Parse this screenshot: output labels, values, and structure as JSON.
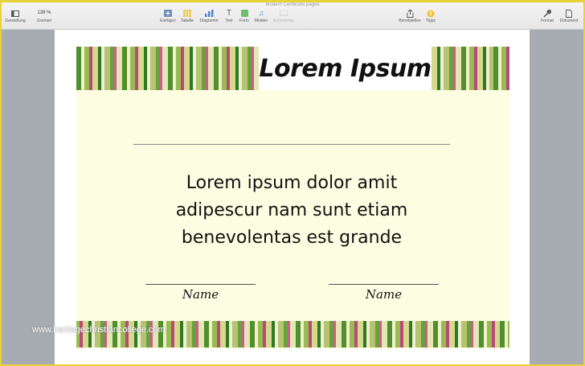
{
  "window": {
    "title": "Modern Certificate.pages"
  },
  "toolbar": {
    "left": [
      {
        "label": "Darstellung",
        "icon": "sidebar-icon"
      },
      {
        "label": "Zoomen",
        "value": "139 %",
        "icon": "zoom-icon"
      }
    ],
    "center": [
      {
        "label": "Einfügen",
        "icon": "insert-icon"
      },
      {
        "label": "Tabelle",
        "icon": "table-icon"
      },
      {
        "label": "Diagramm",
        "icon": "chart-icon"
      },
      {
        "label": "Text",
        "icon": "text-icon"
      },
      {
        "label": "Form",
        "icon": "shape-icon"
      },
      {
        "label": "Medien",
        "icon": "media-icon"
      },
      {
        "label": "Kommentar",
        "icon": "comment-icon",
        "disabled": true
      }
    ],
    "right": [
      {
        "label": "Bereitstellen",
        "icon": "share-icon"
      },
      {
        "label": "Tipps",
        "icon": "tips-icon"
      },
      {
        "label": "Format",
        "icon": "format-icon"
      },
      {
        "label": "Dokument",
        "icon": "document-icon"
      }
    ]
  },
  "certificate": {
    "title": "Lorem Ipsum",
    "body": [
      "Lorem ipsum dolor amit",
      "adipescur nam sunt etiam",
      "benevolentas est grande"
    ],
    "signatures": [
      "Name",
      "Name"
    ]
  },
  "watermark": "www.heritagechristiancollege.com",
  "colors": {
    "frame": "#e8d23a",
    "certificate_background": "#fdfde2",
    "stripe_green": "#4f8f2c",
    "stripe_pink": "#b84a7a",
    "side_pane": "#a7acb3"
  }
}
